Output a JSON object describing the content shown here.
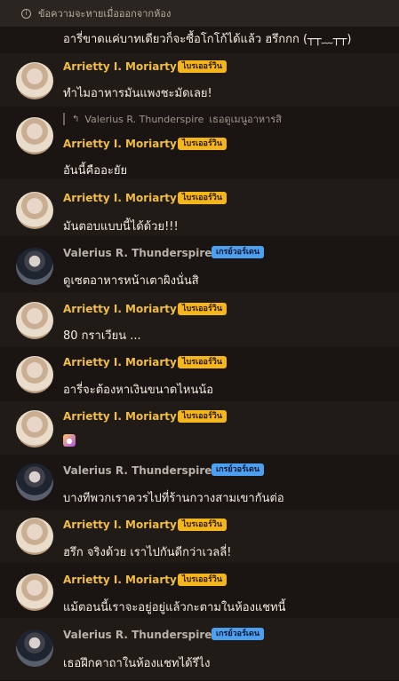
{
  "notice": {
    "text": "ข้อความจะหายเมื่อออกจากห้อง",
    "icon": "info-icon"
  },
  "badges": {
    "arrietty": "ไบรเออร์วิน",
    "valerius": "เกรย์วอร์เดน"
  },
  "users": {
    "arrietty": "Arrietty I. Moriarty",
    "valerius": "Valerius R. Thunderspire"
  },
  "messages": [
    {
      "user": "arrietty",
      "text": "อารี่ขาดแค่บาทเดียวก็จะซื้อโกโก้ได้แล้ว ฮรึกกก (┬┬﹏┬┬)",
      "headerless": true
    },
    {
      "user": "arrietty",
      "text": "ทำไมอาหารมันแพงชะมัดเลย!"
    },
    {
      "user": "arrietty",
      "text": "อันนี้คืออะยัย",
      "reply": {
        "name": "Valerius R. Thunderspire",
        "text": "เธอดูเมนูอาหารสิ"
      }
    },
    {
      "user": "arrietty",
      "text": "มันตอบแบบนี้ได้ด้วย!!!"
    },
    {
      "user": "valerius",
      "text": "ดูเซตอาหารหน้าเตาผิงนั่นสิ"
    },
    {
      "user": "arrietty",
      "text": "80 กราเวียน ..."
    },
    {
      "user": "arrietty",
      "text": "อารี่จะต้องหาเงินขนาดไหนน้อ"
    },
    {
      "user": "arrietty",
      "text": "",
      "emoji": "face-emoji"
    },
    {
      "user": "valerius",
      "text": "บางทีพวกเราควรไปที่ร้านกวางสามเขากันต่อ"
    },
    {
      "user": "arrietty",
      "text": "ฮรึก จริงด้วย เราไปกันดีกว่าเวลลี่!"
    },
    {
      "user": "arrietty",
      "text": "แม้ตอนนี้เราจะอยู่อยู่แล้วกะตามในห้องแชทนี้"
    },
    {
      "user": "valerius",
      "text": "เธอฝึกคาถาในห้องแชทได้รึไง"
    }
  ]
}
